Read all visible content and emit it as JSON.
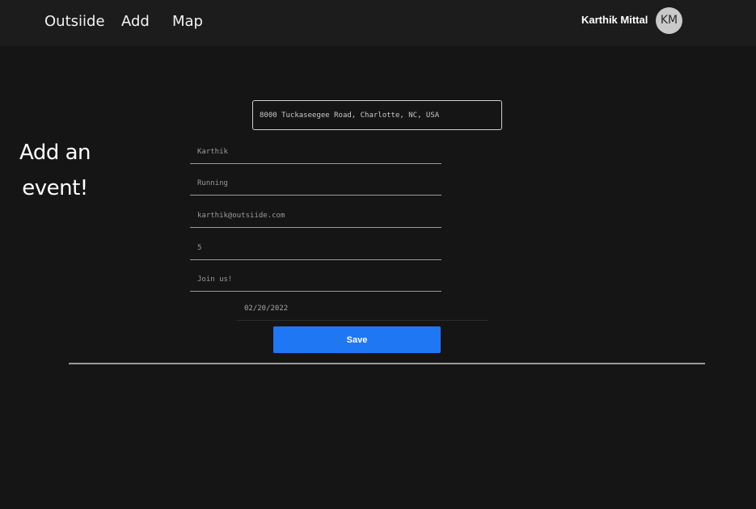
{
  "nav": {
    "brand": "Outsiide",
    "add": "Add",
    "map": "Map"
  },
  "user": {
    "name": "Karthik Mittal",
    "initials": "KM"
  },
  "page": {
    "heading_line1": "Add an",
    "heading_line2": "event!"
  },
  "form": {
    "location": "8000 Tuckaseegee Road, Charlotte, NC, USA",
    "name": "Karthik",
    "activity": "Running",
    "email": "karthik@outsiide.com",
    "count": "5",
    "description": "Join us!",
    "date": "02/20/2022",
    "save_label": "Save"
  },
  "colors": {
    "background": "#151515",
    "topbar": "#1c1c1c",
    "accent": "#1f77f3"
  }
}
